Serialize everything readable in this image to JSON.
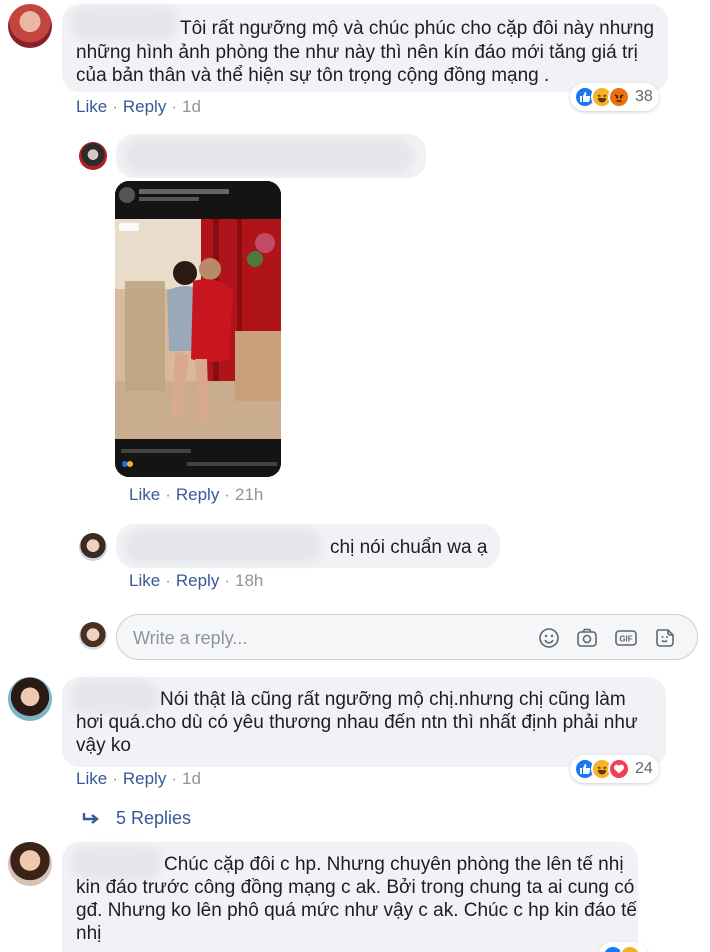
{
  "comments": [
    {
      "text": "Tôi rất ngưỡng mộ và chúc phúc cho cặp đôi này nhưng những hình ảnh phòng the như này thì nên kín đáo mới tăng giá trị của bản thân và thể hiện sự tôn trọng cộng đồng mạng .",
      "line1": "Tôi rất ngưỡng mộ và chúc phúc cho cặp đôi này nhưng",
      "line2": "những hình ảnh phòng the như này thì nên kín đáo mới tăng giá trị",
      "line3": "của bản thân và thể hiện sự tôn trọng cộng đồng mạng .",
      "like": "Like",
      "reply": "Reply",
      "time": "1d",
      "reaction_count": "38"
    },
    {
      "like": "Like",
      "reply": "Reply",
      "time": "21h"
    },
    {
      "text": "chị nói chuẩn wa ạ",
      "like": "Like",
      "reply": "Reply",
      "time": "18h"
    },
    {
      "line1": "Nói thật là cũng rất ngưỡng mộ chị.nhưng chị cũng làm",
      "line2": "hơi quá.cho dù có yêu thương nhau đến ntn thì nhất định phải như",
      "line3": "vậy ko",
      "like": "Like",
      "reply": "Reply",
      "time": "1d",
      "reaction_count": "24",
      "replies_label": "5 Replies"
    },
    {
      "line1": "Chúc cặp đôi c hp. Nhưng chuyên phòng the lên tế nhị",
      "line2": "kin đáo trước công đồng mạng c ak. Bởi trong chung ta ai cung có",
      "line3": "gđ. Nhưng ko lên phô quá mức như vậy c ak. Chúc c hp kin đáo tế",
      "line4": "nhị"
    }
  ],
  "reply_box": {
    "placeholder": "Write a reply..."
  },
  "icons": {
    "reply_box": [
      "emoji-icon",
      "camera-icon",
      "gif-icon",
      "sticker-icon"
    ],
    "reactions": [
      "like-icon",
      "haha-icon",
      "angry-icon",
      "love-icon"
    ]
  },
  "colors": {
    "link": "#385898",
    "bubble": "#f0f2f5",
    "like": "#1877f2",
    "haha": "#f7b125",
    "angry": "#e9710f",
    "love": "#f33e58"
  }
}
